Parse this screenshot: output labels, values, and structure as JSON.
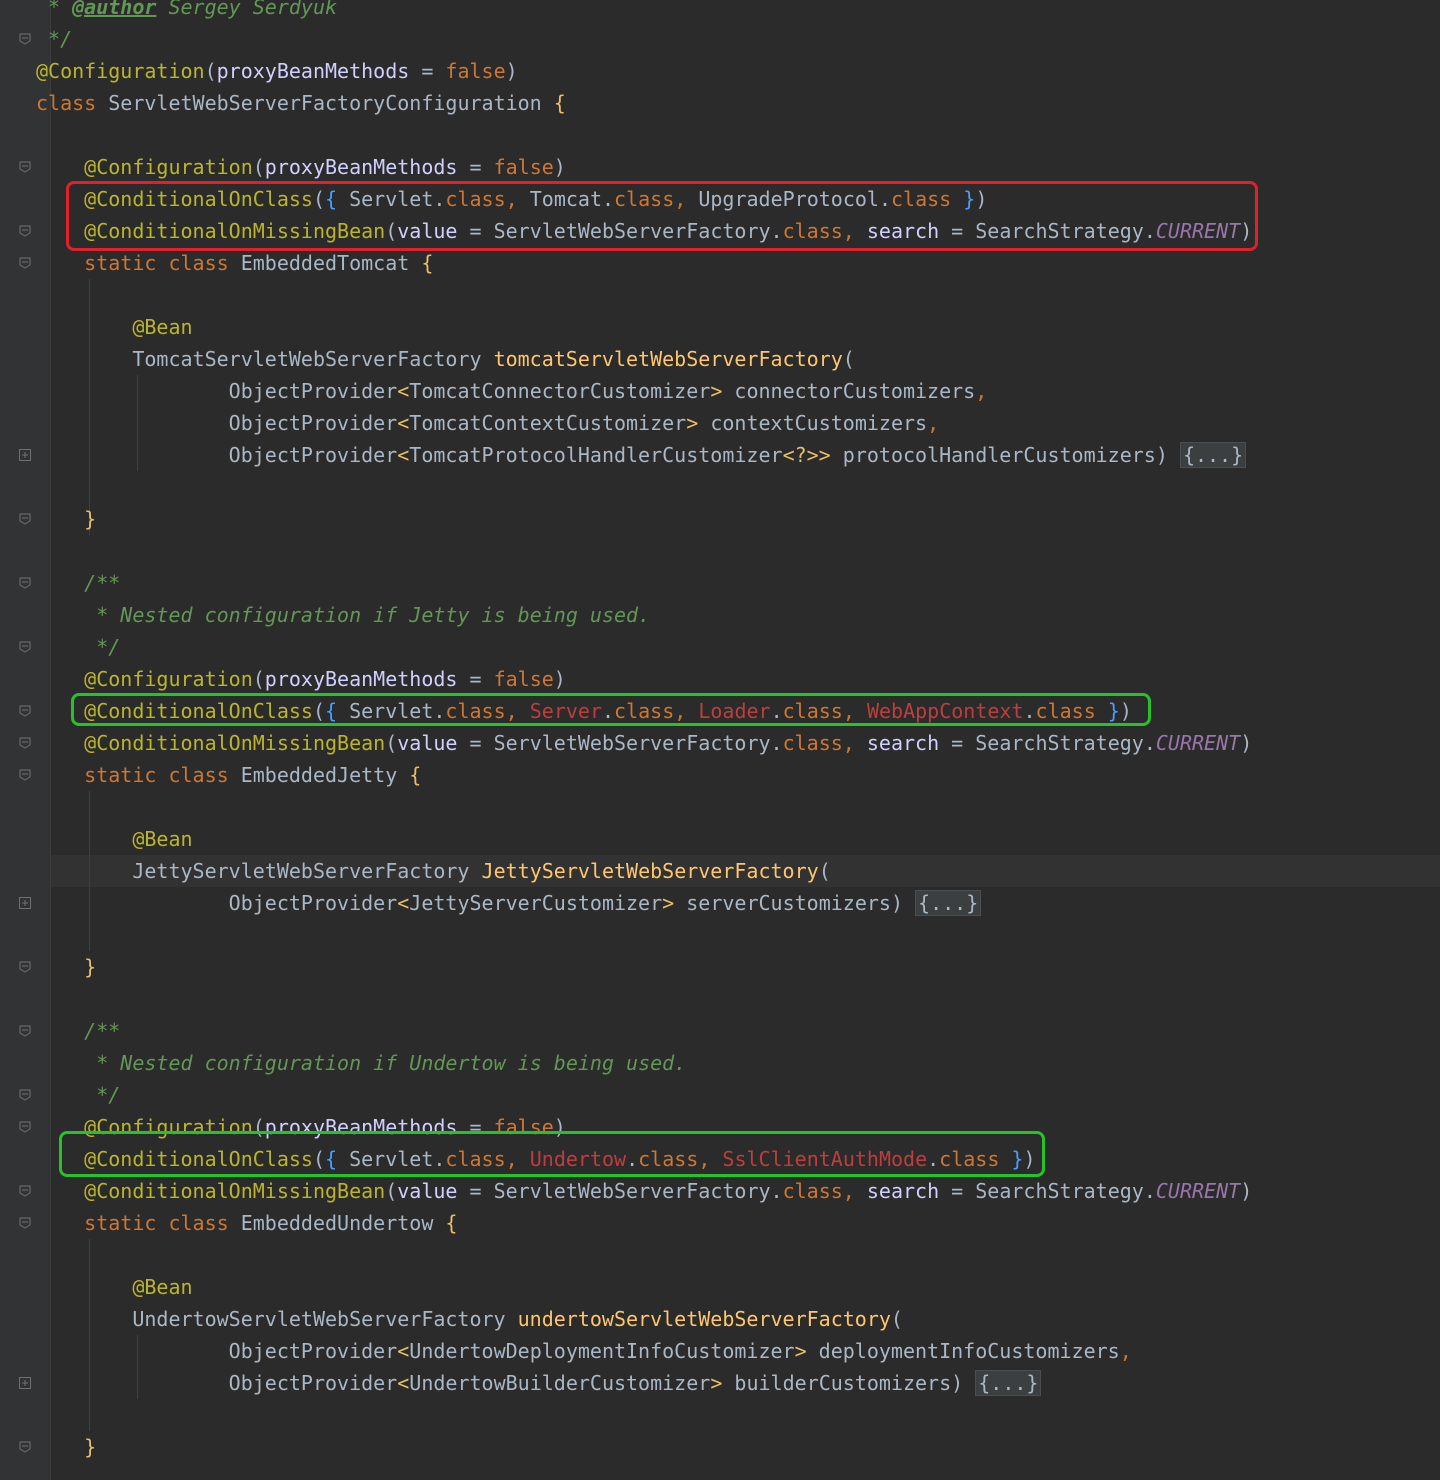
{
  "editor": {
    "theme_colors": {
      "background": "#2b2b2b",
      "gutter": "#313335",
      "highlight_red": "#e0202a",
      "highlight_green": "#27c22a"
    },
    "lines": [
      [
        [
          "c-cm",
          " * "
        ],
        [
          "c-jd",
          "@author"
        ],
        [
          "c-cm",
          " Sergey Serdyuk"
        ]
      ],
      [
        [
          "c-cm",
          " */"
        ]
      ],
      [
        [
          "c-ann",
          "@Configuration"
        ],
        [
          "c-txt",
          "("
        ],
        [
          "c-named",
          "proxyBeanMethods"
        ],
        [
          "c-txt",
          " = "
        ],
        [
          "c-kw",
          "false"
        ],
        [
          "c-txt",
          ")"
        ]
      ],
      [
        [
          "c-kw",
          "class "
        ],
        [
          "c-txt",
          "ServletWebServerFactoryConfiguration "
        ],
        [
          "c-brace",
          "{"
        ]
      ],
      [],
      [
        [
          "c-txt",
          "    "
        ],
        [
          "c-ann",
          "@Configuration"
        ],
        [
          "c-txt",
          "("
        ],
        [
          "c-named",
          "proxyBeanMethods"
        ],
        [
          "c-txt",
          " = "
        ],
        [
          "c-kw",
          "false"
        ],
        [
          "c-txt",
          ")"
        ]
      ],
      [
        [
          "c-txt",
          "    "
        ],
        [
          "c-ann",
          "@ConditionalOnClass"
        ],
        [
          "c-txt",
          "("
        ],
        [
          "c-br",
          "{ "
        ],
        [
          "c-txt",
          "Servlet."
        ],
        [
          "c-kw",
          "class"
        ],
        [
          "c-punct",
          ", "
        ],
        [
          "c-txt",
          "Tomcat."
        ],
        [
          "c-kw",
          "class"
        ],
        [
          "c-punct",
          ", "
        ],
        [
          "c-txt",
          "UpgradeProtocol."
        ],
        [
          "c-kw",
          "class"
        ],
        [
          "c-br",
          " }"
        ],
        [
          "c-txt",
          ")"
        ]
      ],
      [
        [
          "c-txt",
          "    "
        ],
        [
          "c-ann",
          "@ConditionalOnMissingBean"
        ],
        [
          "c-txt",
          "("
        ],
        [
          "c-named",
          "value"
        ],
        [
          "c-txt",
          " = ServletWebServerFactory."
        ],
        [
          "c-kw",
          "class"
        ],
        [
          "c-punct",
          ", "
        ],
        [
          "c-named",
          "search"
        ],
        [
          "c-txt",
          " = SearchStrategy."
        ],
        [
          "c-ital",
          "CURRENT"
        ],
        [
          "c-txt",
          ")"
        ]
      ],
      [
        [
          "c-txt",
          "    "
        ],
        [
          "c-kw",
          "static class "
        ],
        [
          "c-txt",
          "EmbeddedTomcat "
        ],
        [
          "c-brace",
          "{"
        ]
      ],
      [],
      [
        [
          "c-txt",
          "        "
        ],
        [
          "c-ann",
          "@Bean"
        ]
      ],
      [
        [
          "c-txt",
          "        TomcatServletWebServerFactory "
        ],
        [
          "c-fn",
          "tomcatServletWebServerFactory"
        ],
        [
          "c-txt",
          "("
        ]
      ],
      [
        [
          "c-txt",
          "                ObjectProvider"
        ],
        [
          "c-gen",
          "<"
        ],
        [
          "c-txt",
          "TomcatConnectorCustomizer"
        ],
        [
          "c-gen",
          ">"
        ],
        [
          "c-txt",
          " connectorCustomizers"
        ],
        [
          "c-punct",
          ","
        ]
      ],
      [
        [
          "c-txt",
          "                ObjectProvider"
        ],
        [
          "c-gen",
          "<"
        ],
        [
          "c-txt",
          "TomcatContextCustomizer"
        ],
        [
          "c-gen",
          ">"
        ],
        [
          "c-txt",
          " contextCustomizers"
        ],
        [
          "c-punct",
          ","
        ]
      ],
      [
        [
          "c-txt",
          "                ObjectProvider"
        ],
        [
          "c-gen",
          "<"
        ],
        [
          "c-txt",
          "TomcatProtocolHandlerCustomizer"
        ],
        [
          "c-gen",
          "<?>>"
        ],
        [
          "c-txt",
          " protocolHandlerCustomizers) "
        ],
        [
          "c-fold",
          "{...}"
        ]
      ],
      [],
      [
        [
          "c-txt",
          "    "
        ],
        [
          "c-brace",
          "}"
        ]
      ],
      [],
      [
        [
          "c-txt",
          "    "
        ],
        [
          "c-cm",
          "/**"
        ]
      ],
      [
        [
          "c-txt",
          "     "
        ],
        [
          "c-cm",
          "* Nested configuration if Jetty is being used."
        ]
      ],
      [
        [
          "c-txt",
          "     "
        ],
        [
          "c-cm",
          "*/"
        ]
      ],
      [
        [
          "c-txt",
          "    "
        ],
        [
          "c-ann",
          "@Configuration"
        ],
        [
          "c-txt",
          "("
        ],
        [
          "c-named",
          "proxyBeanMethods"
        ],
        [
          "c-txt",
          " = "
        ],
        [
          "c-kw",
          "false"
        ],
        [
          "c-txt",
          ")"
        ]
      ],
      [
        [
          "c-txt",
          "    "
        ],
        [
          "c-ann",
          "@ConditionalOnClass"
        ],
        [
          "c-txt",
          "("
        ],
        [
          "c-br",
          "{ "
        ],
        [
          "c-txt",
          "Servlet."
        ],
        [
          "c-kw",
          "class"
        ],
        [
          "c-punct",
          ", "
        ],
        [
          "c-err",
          "Server"
        ],
        [
          "c-txt",
          "."
        ],
        [
          "c-kw",
          "class"
        ],
        [
          "c-punct",
          ", "
        ],
        [
          "c-err",
          "Loader"
        ],
        [
          "c-txt",
          "."
        ],
        [
          "c-kw",
          "class"
        ],
        [
          "c-punct",
          ", "
        ],
        [
          "c-err",
          "WebAppContext"
        ],
        [
          "c-txt",
          "."
        ],
        [
          "c-kw",
          "class"
        ],
        [
          "c-br",
          " }"
        ],
        [
          "c-txt",
          ")"
        ]
      ],
      [
        [
          "c-txt",
          "    "
        ],
        [
          "c-ann",
          "@ConditionalOnMissingBean"
        ],
        [
          "c-txt",
          "("
        ],
        [
          "c-named",
          "value"
        ],
        [
          "c-txt",
          " = ServletWebServerFactory."
        ],
        [
          "c-kw",
          "class"
        ],
        [
          "c-punct",
          ", "
        ],
        [
          "c-named",
          "search"
        ],
        [
          "c-txt",
          " = SearchStrategy."
        ],
        [
          "c-ital",
          "CURRENT"
        ],
        [
          "c-txt",
          ")"
        ]
      ],
      [
        [
          "c-txt",
          "    "
        ],
        [
          "c-kw",
          "static class "
        ],
        [
          "c-txt",
          "EmbeddedJetty "
        ],
        [
          "c-brace",
          "{"
        ]
      ],
      [],
      [
        [
          "c-txt",
          "        "
        ],
        [
          "c-ann",
          "@Bean"
        ]
      ],
      [
        [
          "c-txt",
          "        JettyServletWebServerFactory "
        ],
        [
          "c-fn",
          "JettyServletWebServerFactory"
        ],
        [
          "c-txt",
          "("
        ]
      ],
      [
        [
          "c-txt",
          "                ObjectProvider"
        ],
        [
          "c-gen",
          "<"
        ],
        [
          "c-txt",
          "JettyServerCustomizer"
        ],
        [
          "c-gen",
          ">"
        ],
        [
          "c-txt",
          " serverCustomizers) "
        ],
        [
          "c-fold",
          "{...}"
        ]
      ],
      [],
      [
        [
          "c-txt",
          "    "
        ],
        [
          "c-brace",
          "}"
        ]
      ],
      [],
      [
        [
          "c-txt",
          "    "
        ],
        [
          "c-cm",
          "/**"
        ]
      ],
      [
        [
          "c-txt",
          "     "
        ],
        [
          "c-cm",
          "* Nested configuration if Undertow is being used."
        ]
      ],
      [
        [
          "c-txt",
          "     "
        ],
        [
          "c-cm",
          "*/"
        ]
      ],
      [
        [
          "c-txt",
          "    "
        ],
        [
          "c-ann",
          "@Configuration"
        ],
        [
          "c-txt",
          "("
        ],
        [
          "c-named",
          "proxyBeanMethods"
        ],
        [
          "c-txt",
          " = "
        ],
        [
          "c-kw",
          "false"
        ],
        [
          "c-txt",
          ")"
        ]
      ],
      [
        [
          "c-txt",
          "    "
        ],
        [
          "c-ann",
          "@ConditionalOnClass"
        ],
        [
          "c-txt",
          "("
        ],
        [
          "c-br",
          "{ "
        ],
        [
          "c-txt",
          "Servlet."
        ],
        [
          "c-kw",
          "class"
        ],
        [
          "c-punct",
          ", "
        ],
        [
          "c-err",
          "Undertow"
        ],
        [
          "c-txt",
          "."
        ],
        [
          "c-kw",
          "class"
        ],
        [
          "c-punct",
          ", "
        ],
        [
          "c-err",
          "SslClientAuthMode"
        ],
        [
          "c-txt",
          "."
        ],
        [
          "c-kw",
          "class"
        ],
        [
          "c-br",
          " }"
        ],
        [
          "c-txt",
          ")"
        ]
      ],
      [
        [
          "c-txt",
          "    "
        ],
        [
          "c-ann",
          "@ConditionalOnMissingBean"
        ],
        [
          "c-txt",
          "("
        ],
        [
          "c-named",
          "value"
        ],
        [
          "c-txt",
          " = ServletWebServerFactory."
        ],
        [
          "c-kw",
          "class"
        ],
        [
          "c-punct",
          ", "
        ],
        [
          "c-named",
          "search"
        ],
        [
          "c-txt",
          " = SearchStrategy."
        ],
        [
          "c-ital",
          "CURRENT"
        ],
        [
          "c-txt",
          ")"
        ]
      ],
      [
        [
          "c-txt",
          "    "
        ],
        [
          "c-kw",
          "static class "
        ],
        [
          "c-txt",
          "EmbeddedUndertow "
        ],
        [
          "c-brace",
          "{"
        ]
      ],
      [],
      [
        [
          "c-txt",
          "        "
        ],
        [
          "c-ann",
          "@Bean"
        ]
      ],
      [
        [
          "c-txt",
          "        UndertowServletWebServerFactory "
        ],
        [
          "c-fn",
          "undertowServletWebServerFactory"
        ],
        [
          "c-txt",
          "("
        ]
      ],
      [
        [
          "c-txt",
          "                ObjectProvider"
        ],
        [
          "c-gen",
          "<"
        ],
        [
          "c-txt",
          "UndertowDeploymentInfoCustomizer"
        ],
        [
          "c-gen",
          ">"
        ],
        [
          "c-txt",
          " deploymentInfoCustomizers"
        ],
        [
          "c-punct",
          ","
        ]
      ],
      [
        [
          "c-txt",
          "                ObjectProvider"
        ],
        [
          "c-gen",
          "<"
        ],
        [
          "c-txt",
          "UndertowBuilderCustomizer"
        ],
        [
          "c-gen",
          ">"
        ],
        [
          "c-txt",
          " builderCustomizers) "
        ],
        [
          "c-fold",
          "{...}"
        ]
      ],
      [],
      [
        [
          "c-txt",
          "    "
        ],
        [
          "c-brace",
          "}"
        ]
      ]
    ]
  }
}
